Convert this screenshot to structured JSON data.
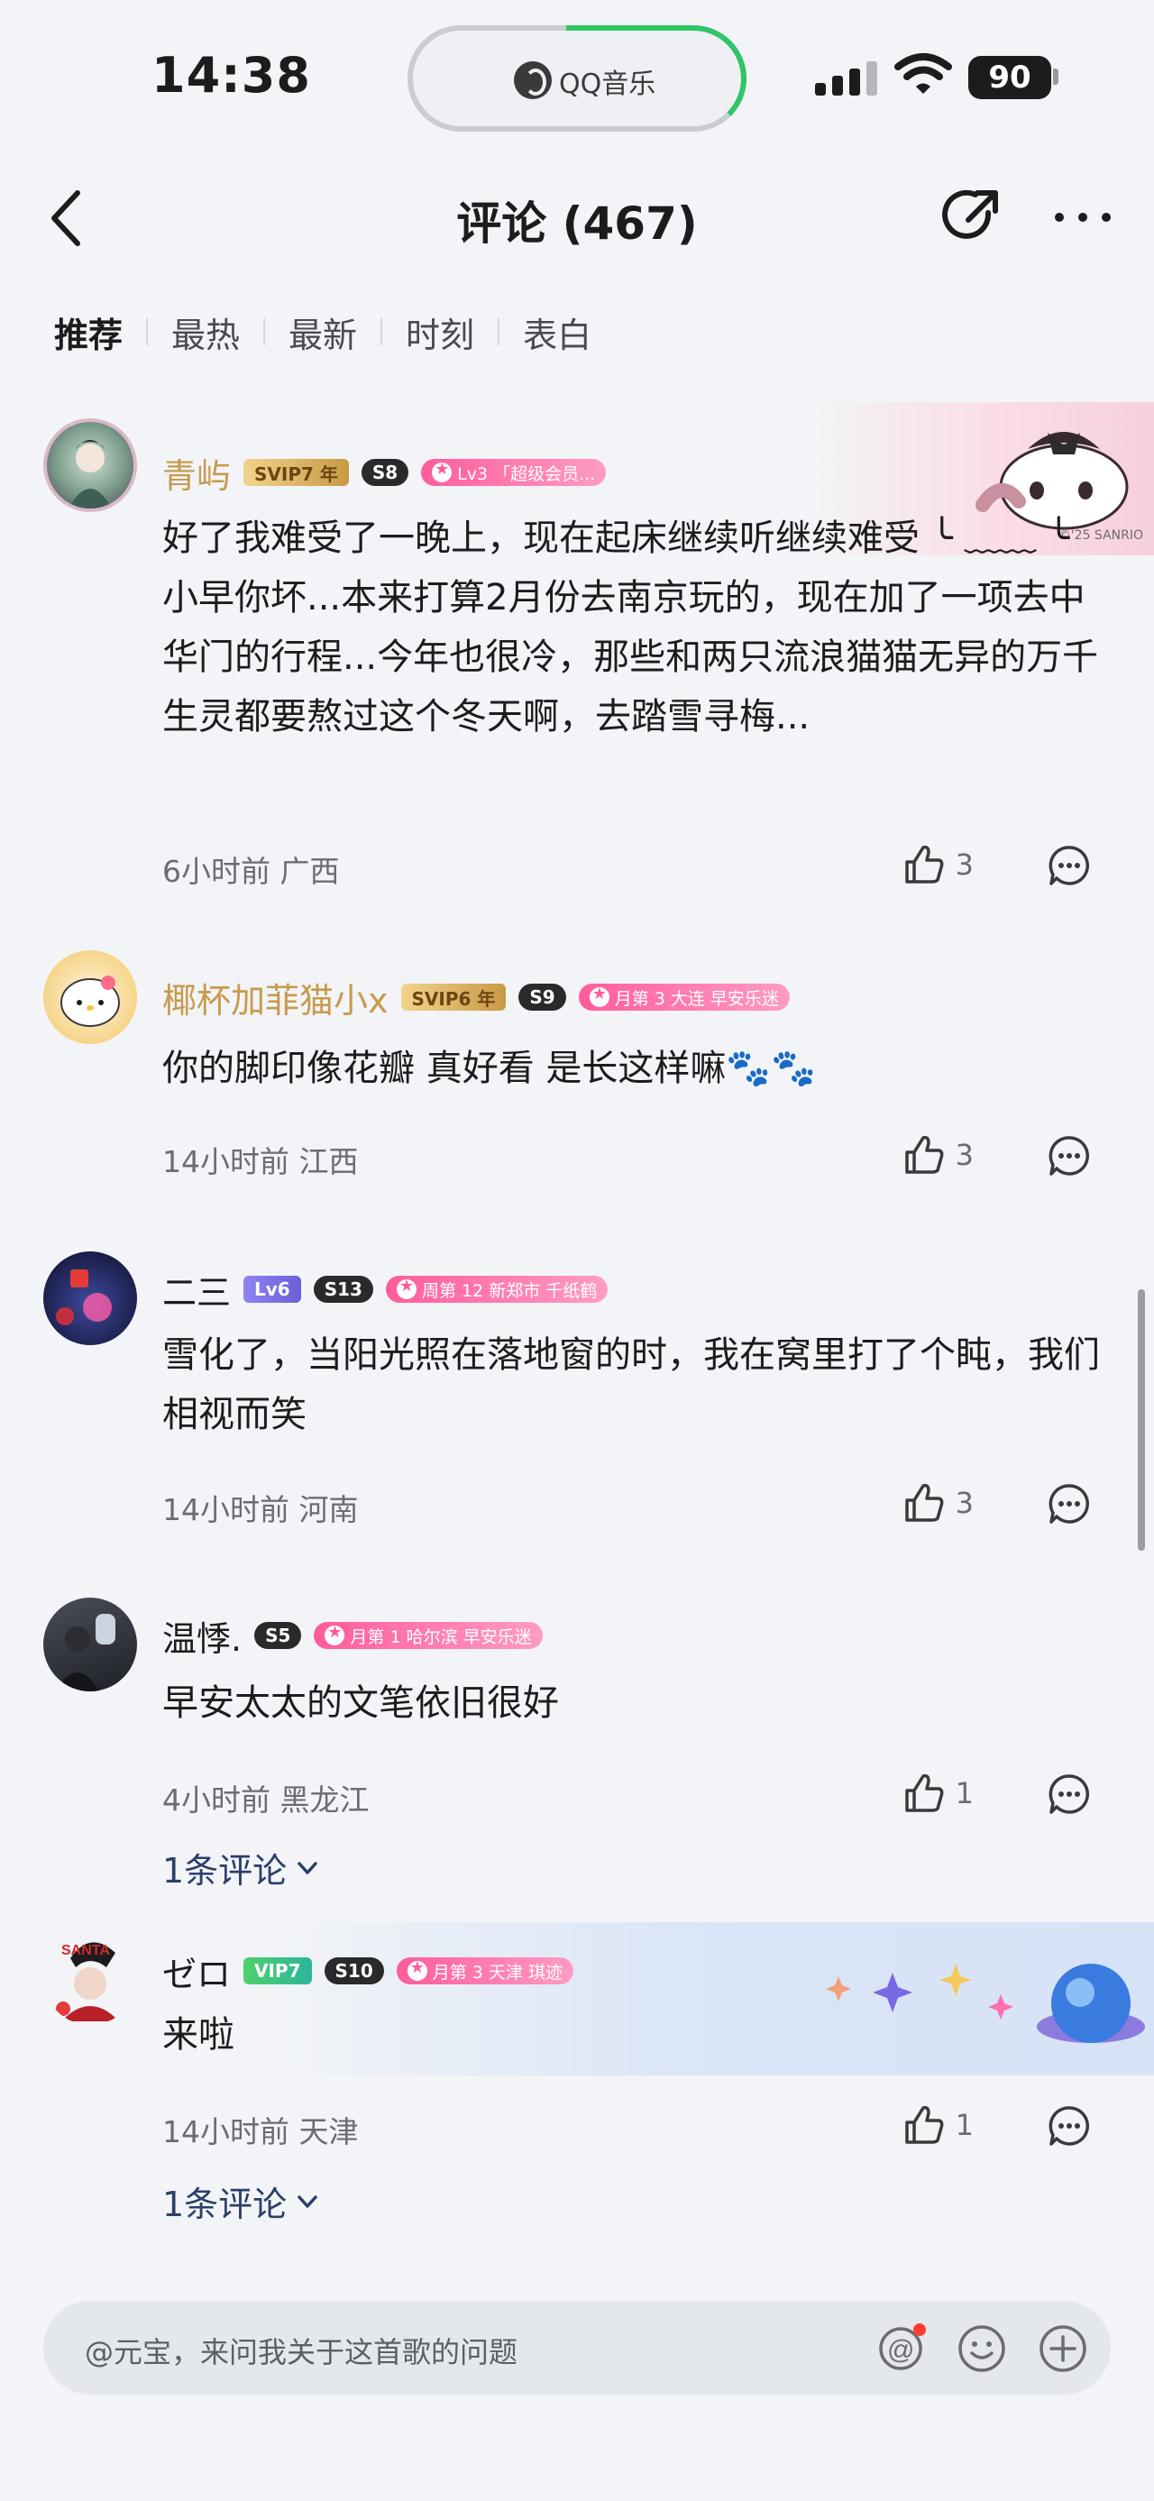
{
  "status_bar": {
    "time": "14:38",
    "app_indicator": "QQ音乐",
    "battery": "90",
    "accent_color": "#2fc567"
  },
  "header": {
    "title": "评论 (467)"
  },
  "tabs": [
    {
      "label": "推荐",
      "active": true
    },
    {
      "label": "最热",
      "active": false
    },
    {
      "label": "最新",
      "active": false
    },
    {
      "label": "时刻",
      "active": false
    },
    {
      "label": "表白",
      "active": false
    }
  ],
  "comments": [
    {
      "username": "青屿",
      "badges": [
        "SVIP7 年",
        "S8",
        "Lv3 「超级会员..."
      ],
      "content": "好了我难受了一晚上，现在起床继续听继续难受 ╰ ﹏﹏ ╰小早你坏...本来打算2月份去南京玩的，现在加了一项去中华门的行程...今年也很冷，那些和两只流浪猫猫无异的万千生灵都要熬过这个冬天啊，去踏雪寻梅...",
      "time": "6小时前",
      "location": "广西",
      "likes": "3",
      "banner_text": "©'25 SANRIO"
    },
    {
      "username": "椰杯加菲猫小x",
      "badges": [
        "SVIP6 年",
        "S9",
        "月第 3 大连 早安乐迷"
      ],
      "content": "你的脚印像花瓣 真好看 是长这样嘛🐾🐾",
      "time": "14小时前",
      "location": "江西",
      "likes": "3"
    },
    {
      "username": "二三",
      "badges": [
        "Lv6",
        "S13",
        "周第 12 新郑市 千纸鹤"
      ],
      "content": "雪化了，当阳光照在落地窗的时，我在窝里打了个盹，我们相视而笑",
      "time": "14小时前",
      "location": "河南",
      "likes": "3"
    },
    {
      "username": "温悸.",
      "badges": [
        "S5",
        "月第 1 哈尔滨 早安乐迷"
      ],
      "content": "早安太太的文笔依旧很好",
      "time": "4小时前",
      "location": "黑龙江",
      "likes": "1",
      "reply_link": "1条评论"
    },
    {
      "username": "ゼロ",
      "badges": [
        "VIP7",
        "S10",
        "月第 3 天津 琪迹"
      ],
      "content": "来啦",
      "time": "14小时前",
      "location": "天津",
      "likes": "1",
      "reply_link": "1条评论"
    }
  ],
  "input": {
    "placeholder": "@元宝，来问我关于这首歌的问题"
  }
}
